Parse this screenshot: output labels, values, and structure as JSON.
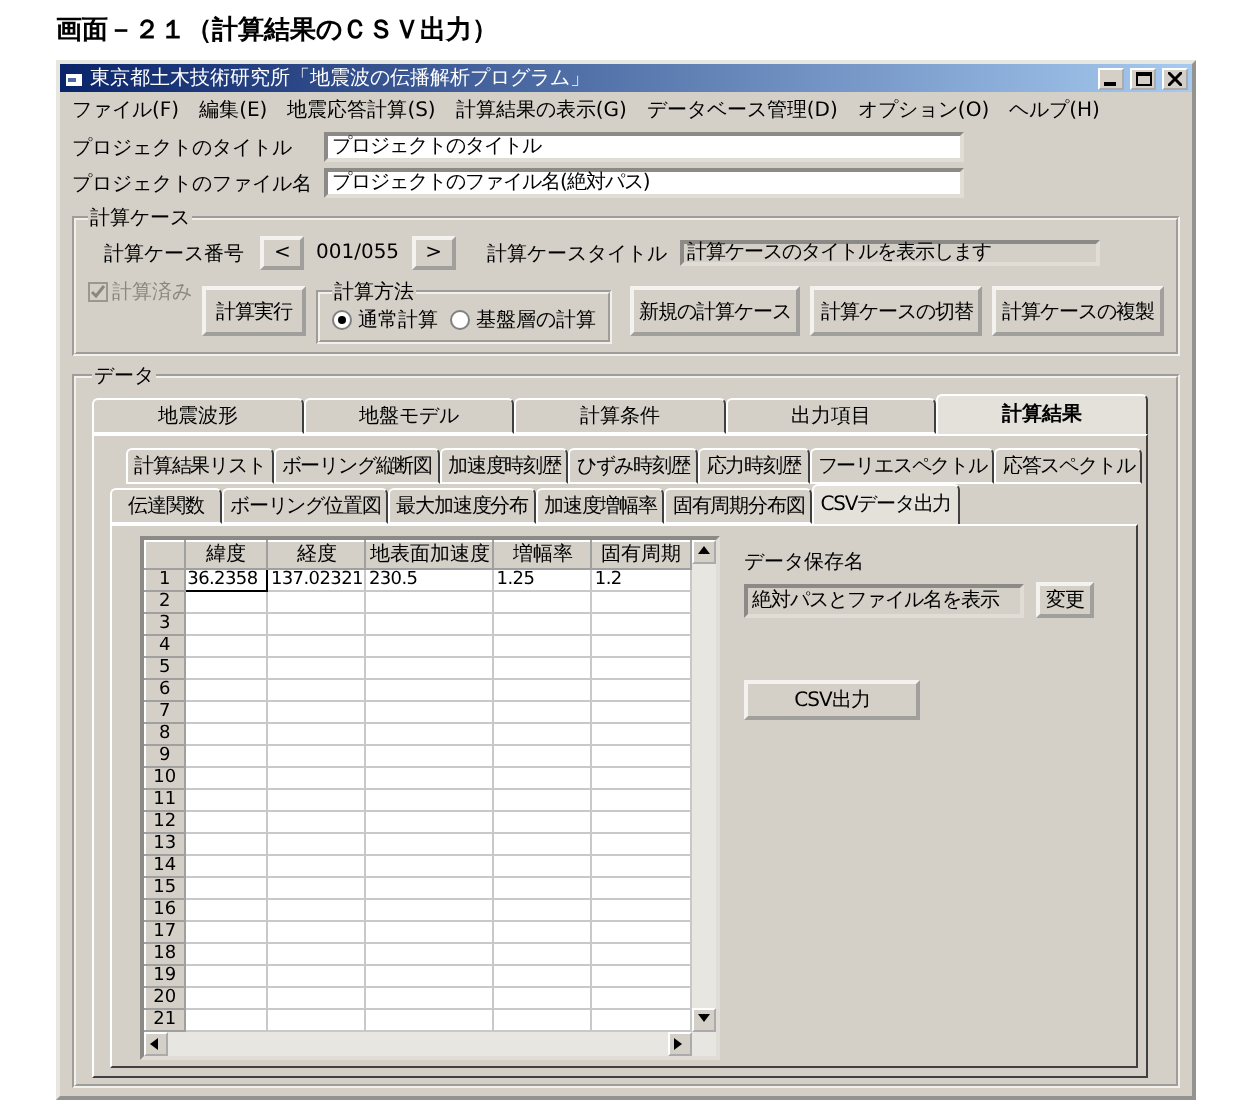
{
  "doc_title": "画面－２１（計算結果のＣＳＶ出力）",
  "window": {
    "title": "東京都土木技術研究所「地震波の伝播解析プログラム」"
  },
  "menu": [
    "ファイル(F)",
    "編集(E)",
    "地震応答計算(S)",
    "計算結果の表示(G)",
    "データベース管理(D)",
    "オプション(O)",
    "ヘルプ(H)"
  ],
  "project": [
    {
      "label": "プロジェクトのタイトル",
      "value": "プロジェクトのタイトル"
    },
    {
      "label": "プロジェクトのファイル名",
      "value": "プロジェクトのファイル名(絶対パス)"
    }
  ],
  "calc_case": {
    "legend": "計算ケース",
    "number_label": "計算ケース番号",
    "prev": "<",
    "counter": "001/055",
    "next": ">",
    "title_label": "計算ケースタイトル",
    "title_value": "計算ケースのタイトルを表示します",
    "done": {
      "label": "計算済み",
      "checked": true,
      "disabled": true
    },
    "run": "計算実行",
    "method": {
      "legend": "計算方法",
      "options": [
        {
          "label": "通常計算",
          "selected": true
        },
        {
          "label": "基盤層の計算",
          "selected": false
        }
      ]
    },
    "buttons": [
      "新規の計算ケース",
      "計算ケースの切替",
      "計算ケースの複製"
    ]
  },
  "data": {
    "legend": "データ",
    "tabs": [
      {
        "label": "地震波形",
        "selected": false
      },
      {
        "label": "地盤モデル",
        "selected": false
      },
      {
        "label": "計算条件",
        "selected": false
      },
      {
        "label": "出力項目",
        "selected": false
      },
      {
        "label": "計算結果",
        "selected": true
      }
    ],
    "subtab_rows": [
      [
        {
          "label": "計算結果リスト",
          "selected": false
        },
        {
          "label": "ボーリング縦断図",
          "selected": false
        },
        {
          "label": "加速度時刻歴",
          "selected": false
        },
        {
          "label": "ひずみ時刻歴",
          "selected": false
        },
        {
          "label": "応力時刻歴",
          "selected": false
        },
        {
          "label": "フーリエスペクトル",
          "selected": false
        },
        {
          "label": "応答スペクトル",
          "selected": false
        }
      ],
      [
        {
          "label": "伝達関数",
          "selected": false
        },
        {
          "label": "ボーリング位置図",
          "selected": false
        },
        {
          "label": "最大加速度分布",
          "selected": false
        },
        {
          "label": "加速度増幅率",
          "selected": false
        },
        {
          "label": "固有周期分布図",
          "selected": false
        },
        {
          "label": "CSVデータ出力",
          "selected": true
        }
      ]
    ],
    "table": {
      "columns": [
        "緯度",
        "経度",
        "地表面加速度",
        "増幅率",
        "固有周期"
      ],
      "rows": [
        {
          "header": "1",
          "cells": [
            "36.2358",
            "137.02321",
            "230.5",
            "1.25",
            "1.2"
          ]
        },
        {
          "header": "2"
        },
        {
          "header": "3"
        },
        {
          "header": "4"
        },
        {
          "header": "5"
        },
        {
          "header": "6"
        },
        {
          "header": "7"
        },
        {
          "header": "8"
        },
        {
          "header": "9"
        },
        {
          "header": "10"
        },
        {
          "header": "11"
        },
        {
          "header": "12"
        },
        {
          "header": "13"
        },
        {
          "header": "14"
        },
        {
          "header": "15"
        },
        {
          "header": "16"
        },
        {
          "header": "17"
        },
        {
          "header": "18"
        },
        {
          "header": "19"
        },
        {
          "header": "20"
        },
        {
          "header": "21"
        }
      ]
    },
    "save_label": "データ保存名",
    "save_value": "絶対パスとファイル名を表示",
    "change": "変更",
    "export": "CSV出力"
  }
}
